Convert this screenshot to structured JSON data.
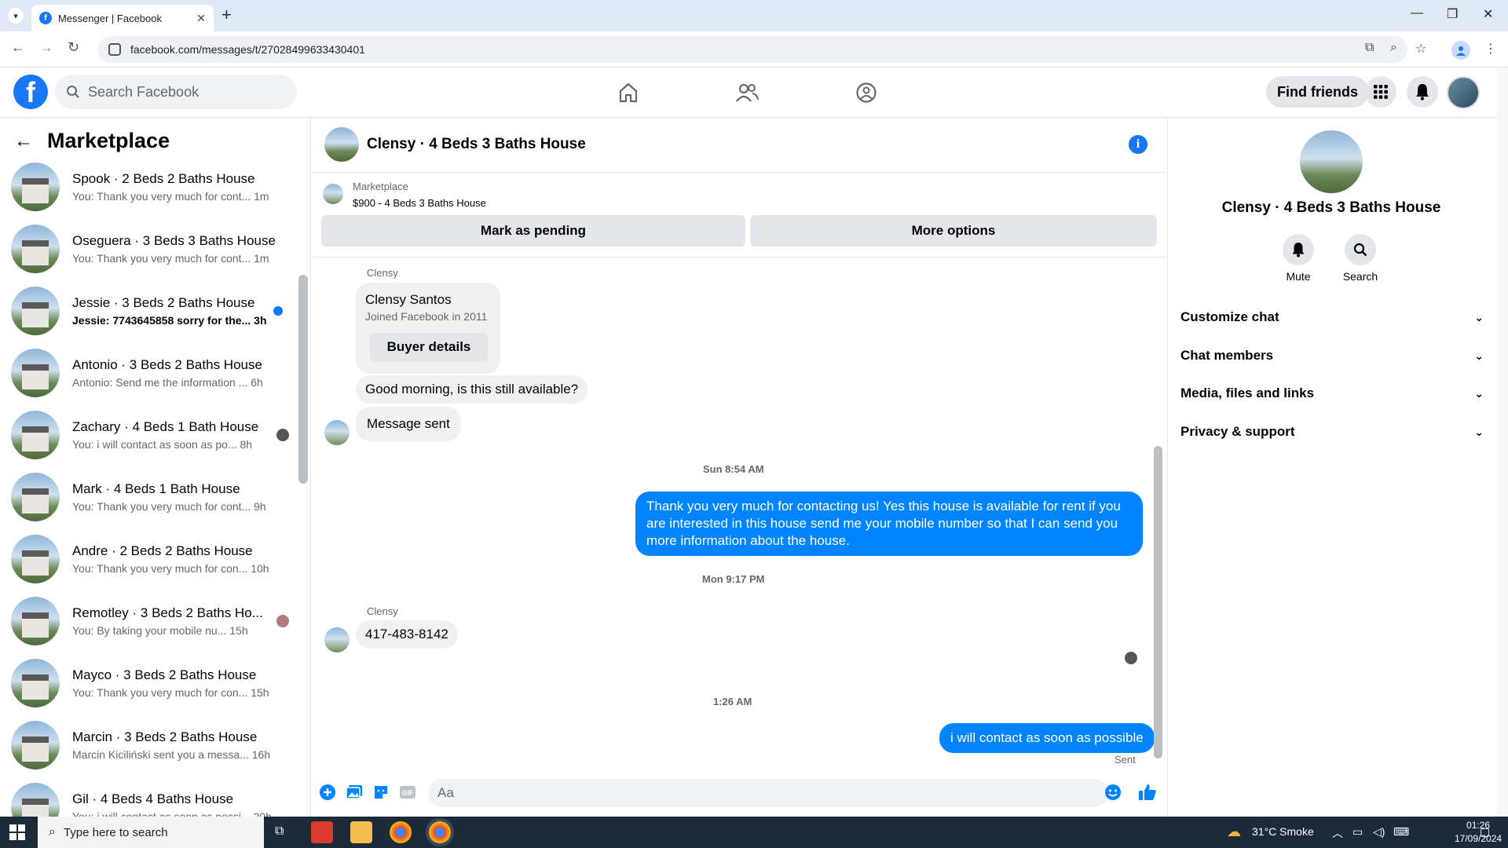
{
  "browser": {
    "tab_title": "Messenger | Facebook",
    "url": "facebook.com/messages/t/27028499633430401"
  },
  "header": {
    "search_placeholder": "Search Facebook",
    "find_friends": "Find friends"
  },
  "sidebar": {
    "title": "Marketplace",
    "conversations": [
      {
        "title": "Spook · 2 Beds 2 Baths House",
        "preview": "You: Thank you very much for cont...",
        "time": "1m",
        "unread": false
      },
      {
        "title": "Oseguera · 3 Beds 3 Baths House",
        "preview": "You: Thank you very much for cont...",
        "time": "1m",
        "unread": false
      },
      {
        "title": "Jessie · 3 Beds 2 Baths House",
        "preview": "Jessie: 7743645858 sorry for the...",
        "time": "3h",
        "unread": true
      },
      {
        "title": "Antonio · 3 Beds 2 Baths House",
        "preview": "Antonio: Send me the information ...",
        "time": "6h",
        "unread": false
      },
      {
        "title": "Zachary · 4 Beds 1 Bath House",
        "preview": "You: i will contact as soon as po...",
        "time": "8h",
        "unread": false
      },
      {
        "title": "Mark · 4 Beds 1 Bath House",
        "preview": "You: Thank you very much for cont...",
        "time": "9h",
        "unread": false
      },
      {
        "title": "Andre · 2 Beds 2 Baths House",
        "preview": "You: Thank you very much for con...",
        "time": "10h",
        "unread": false
      },
      {
        "title": "Remotley · 3 Beds 2 Baths Ho...",
        "preview": "You: By taking your mobile nu...",
        "time": "15h",
        "unread": false
      },
      {
        "title": "Mayco · 3 Beds 2 Baths House",
        "preview": "You: Thank you very much for con...",
        "time": "15h",
        "unread": false
      },
      {
        "title": "Marcin · 3 Beds 2 Baths House",
        "preview": "Marcin Kiciliński sent you a messa...",
        "time": "16h",
        "unread": false
      },
      {
        "title": "Gil · 4 Beds 4 Baths House",
        "preview": "You: i will contact as soon as possi...",
        "time": "20h",
        "unread": false
      }
    ]
  },
  "chat": {
    "title": "Clensy · 4 Beds 3 Baths House",
    "marketplace_label": "Marketplace",
    "listing": "$900 - 4 Beds 3 Baths House",
    "mark_pending": "Mark as pending",
    "more_options": "More options",
    "sender_name": "Clensy",
    "buyer_name": "Clensy Santos",
    "buyer_joined": "Joined Facebook in 2011",
    "buyer_details": "Buyer details",
    "msg1": "Good morning, is this still available?",
    "msg2": "Message sent",
    "ts1": "Sun 8:54 AM",
    "reply1": "Thank you very much for contacting us! Yes this house is available for rent if you are interested in this house send me your mobile number so that I can send you more information about the house.",
    "ts2": "Mon 9:17 PM",
    "sender_name2": "Clensy",
    "msg3": "417-483-8142",
    "ts3": "1:26 AM",
    "reply2": "i will contact as soon as possible",
    "status": "Sent",
    "composer_placeholder": "Aa"
  },
  "right_panel": {
    "name": "Clensy · 4 Beds 3 Baths House",
    "mute": "Mute",
    "search": "Search",
    "sections": [
      "Customize chat",
      "Chat members",
      "Media, files and links",
      "Privacy & support"
    ]
  },
  "taskbar": {
    "search_placeholder": "Type here to search",
    "weather": "31°C  Smoke",
    "time": "01:26",
    "date": "17/09/2024"
  },
  "colors": {
    "brand": "#1877f2",
    "outgoing_bubble": "#0084ff",
    "incoming_bubble": "#f0f0f0"
  }
}
